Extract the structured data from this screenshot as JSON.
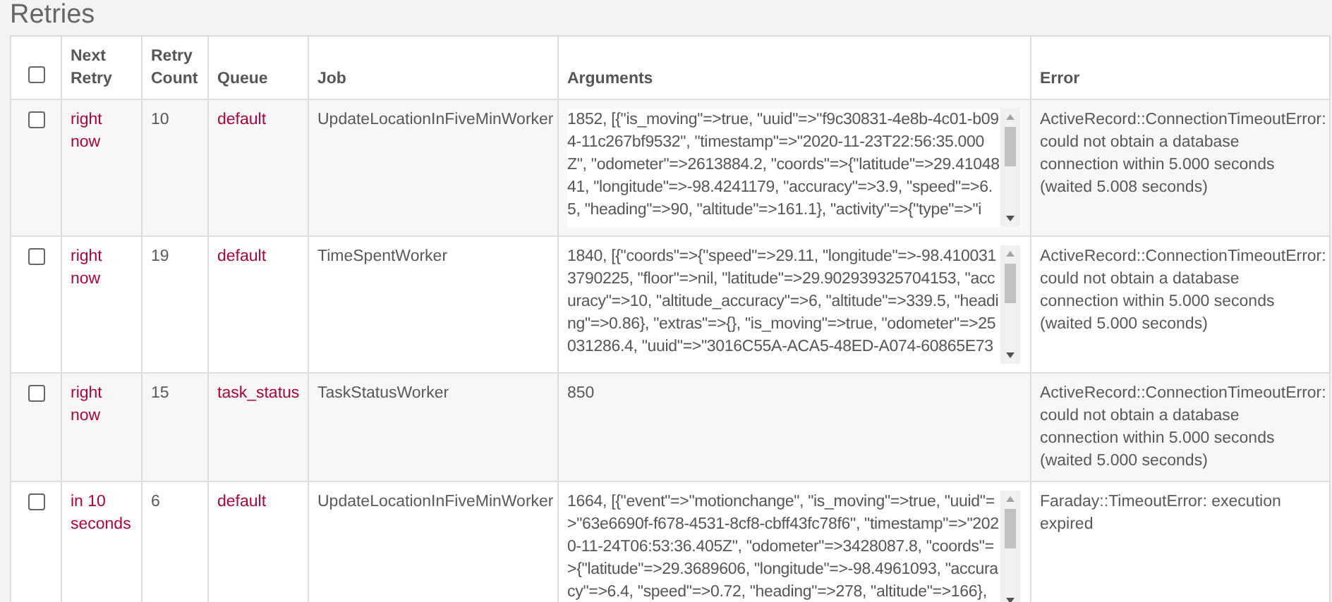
{
  "page": {
    "title": "Retries"
  },
  "table": {
    "select_all": {
      "checked": false
    },
    "columns": [
      "Next Retry",
      "Retry Count",
      "Queue",
      "Job",
      "Arguments",
      "Error"
    ],
    "rows": [
      {
        "checked": false,
        "next_retry": "right now",
        "retry_count": "10",
        "queue": "default",
        "job": "UpdateLocationInFiveMinWorker",
        "arguments": "1852, [{\"is_moving\"=>true, \"uuid\"=>\"f9c30831-4e8b-4c01-b094-11c267bf9532\", \"timestamp\"=>\"2020-11-23T22:56:35.000Z\", \"odometer\"=>2613884.2, \"coords\"=>{\"latitude\"=>29.4104841, \"longitude\"=>-98.4241179, \"accuracy\"=>3.9, \"speed\"=>6.5, \"heading\"=>90, \"altitude\"=>161.1}, \"activity\"=>{\"type\"=>\"i",
        "scrollable": true,
        "error": "ActiveRecord::ConnectionTimeoutError: could not obtain a database connection within 5.000 seconds (waited 5.008 seconds)"
      },
      {
        "checked": false,
        "next_retry": "right now",
        "retry_count": "19",
        "queue": "default",
        "job": "TimeSpentWorker",
        "arguments": "1840, [{\"coords\"=>{\"speed\"=>29.11, \"longitude\"=>-98.4100313790225, \"floor\"=>nil, \"latitude\"=>29.902939325704153, \"accuracy\"=>10, \"altitude_accuracy\"=>6, \"altitude\"=>339.5, \"heading\"=>0.86}, \"extras\"=>{}, \"is_moving\"=>true, \"odometer\"=>25031286.4, \"uuid\"=>\"3016C55A-ACA5-48ED-A074-60865E73",
        "scrollable": true,
        "error": "ActiveRecord::ConnectionTimeoutError: could not obtain a database connection within 5.000 seconds (waited 5.000 seconds)"
      },
      {
        "checked": false,
        "next_retry": "right now",
        "retry_count": "15",
        "queue": "task_status",
        "job": "TaskStatusWorker",
        "arguments": "850",
        "scrollable": false,
        "error": "ActiveRecord::ConnectionTimeoutError: could not obtain a database connection within 5.000 seconds (waited 5.000 seconds)"
      },
      {
        "checked": false,
        "next_retry": "in 10 seconds",
        "retry_count": "6",
        "queue": "default",
        "job": "UpdateLocationInFiveMinWorker",
        "arguments": "1664, [{\"event\"=>\"motionchange\", \"is_moving\"=>true, \"uuid\"=>\"63e6690f-f678-4531-8cf8-cbff43fc78f6\", \"timestamp\"=>\"2020-11-24T06:53:36.405Z\", \"odometer\"=>3428087.8, \"coords\"=>{\"latitude\"=>29.3689606, \"longitude\"=>-98.4961093, \"accuracy\"=>6.4, \"speed\"=>0.72, \"heading\"=>278, \"altitude\"=>166},",
        "scrollable": true,
        "error": "Faraday::TimeoutError: execution expired"
      }
    ]
  }
}
